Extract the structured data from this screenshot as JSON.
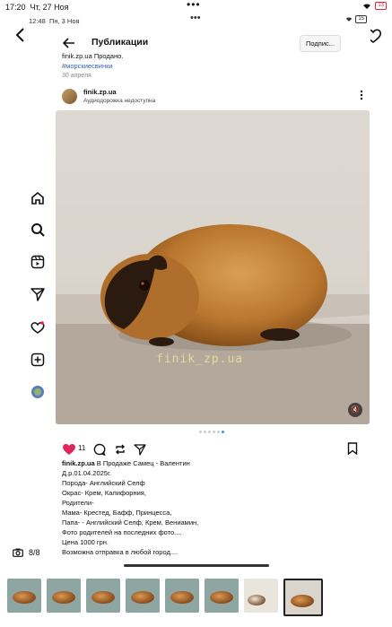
{
  "outer_status": {
    "time": "17:20",
    "date": "Чт, 27 Ноя",
    "dots": "•••",
    "battery": "13"
  },
  "inner_status": {
    "time": "12:48",
    "date": "Пн, 3 Ноя",
    "dots": "•••",
    "battery": "15"
  },
  "header": {
    "title": "Публикации",
    "subscribe": "Подпис..."
  },
  "prev_post": {
    "line1": "finik.zp.ua Продано.",
    "hashtag": "#морскиесвинки",
    "date": "30 апреля"
  },
  "post": {
    "username": "finik.zp.ua",
    "audio": "Аудиодорожка недоступна",
    "watermark": "finik_zp.ua",
    "likes": "11",
    "caption_user": "finik.zp.ua",
    "caption_lines": [
      "В Продаже Самец - Валентин",
      "Д.р.01.04.2025г.",
      "Порода- Английский Селф",
      "Окрас- Крем, Калифорния,",
      "Родители-",
      "Мама- Крестед, Бафф, Принцесса,",
      "Папа- - Английский Селф, Крем, Вениамин,",
      "Фото родителей на последних фото....",
      "Цена 1000 грн.",
      "Возможна отправка в любой город...."
    ]
  },
  "viewer": {
    "counter": "8/8"
  },
  "colors": {
    "link": "#3a5fb0",
    "like": "#e0245e",
    "dot_active": "#3897f0"
  }
}
